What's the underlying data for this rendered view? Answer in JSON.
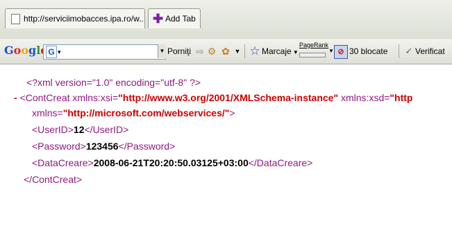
{
  "tabs": {
    "page_url": "http://serviciimobacces.ipa.ro/w...",
    "add_tab_label": "Add Tab"
  },
  "toolbar": {
    "google_logo": "Google",
    "search_prefix": "G",
    "porniti_label": "Porniţi",
    "marcaje_label": "Marcaje",
    "pagerank_label": "PageRank",
    "blocked_label": "30 blocate",
    "spellcheck_label": "Verificat",
    "icons": [
      "google-g-icon",
      "dropdown-icon",
      "forward-icon",
      "settings-icon",
      "puzzle-icon",
      "star-icon",
      "pagerank-icon",
      "popup-blocker-icon",
      "spellcheck-icon"
    ]
  },
  "xml": {
    "decl": "<?xml version=\"1.0\" encoding=\"utf-8\" ?>",
    "minus": "-",
    "root_open": "<ContCreat",
    "xmlns_xsi_attr": " xmlns:xsi=",
    "xmlns_xsi_val": "\"http://www.w3.org/2001/XMLSchema-instance\"",
    "xmlns_xsd_attr": " xmlns:xsd=",
    "xmlns_xsd_val": "\"http",
    "xmlns_attr": "xmlns=",
    "xmlns_val": "\"http://microsoft.com/webservices/\"",
    "xmlns_end": ">",
    "userid_open": "<UserID>",
    "userid_val": "12",
    "userid_close": "</UserID>",
    "password_open": "<Password>",
    "password_val": "123456",
    "password_close": "</Password>",
    "data_open": "<DataCreare>",
    "data_val": "2008-06-21T20:20:50.03125+03:00",
    "data_close": "</DataCreare>",
    "root_close": "</ContCreat>"
  }
}
